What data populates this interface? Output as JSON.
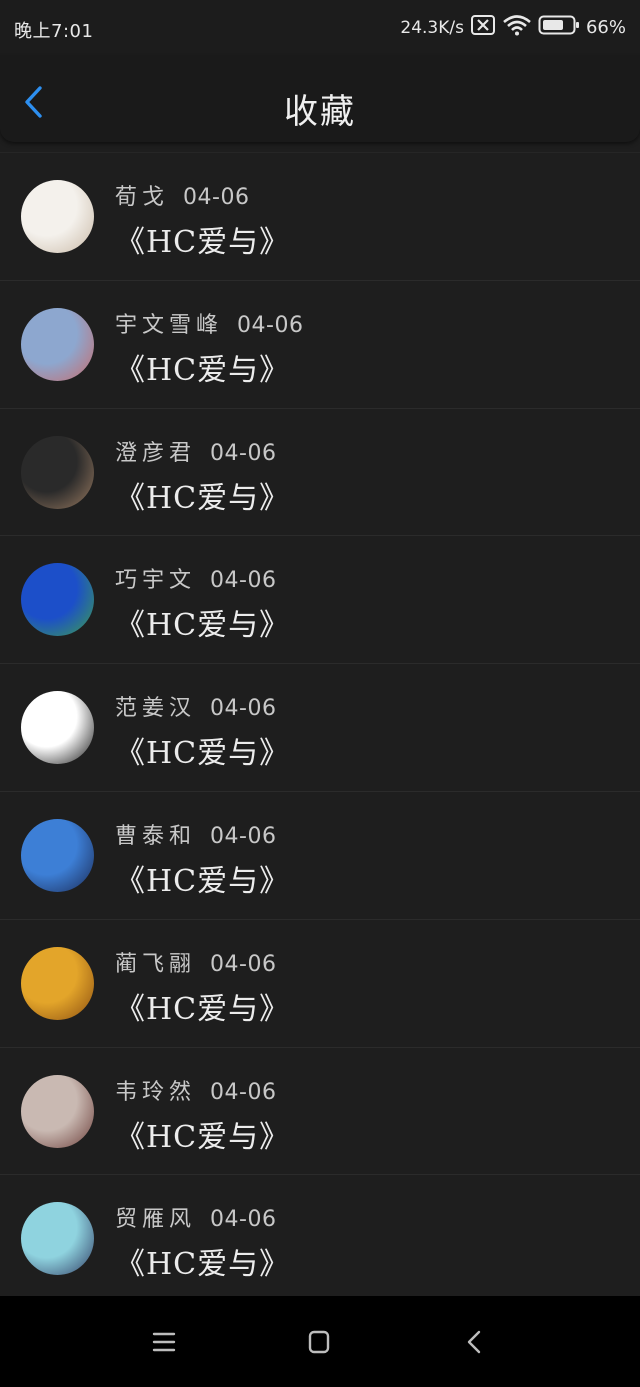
{
  "status_bar": {
    "time": "晚上7:01",
    "net_speed": "24.3K/s",
    "battery": "66%"
  },
  "header": {
    "title": "收藏"
  },
  "items": [
    {
      "name": "荀戈",
      "date": "04-06",
      "title": "《HC爱与》",
      "avatar_colors": [
        "#f4f1ec",
        "#c9b9a6"
      ]
    },
    {
      "name": "宇文雪峰",
      "date": "04-06",
      "title": "《HC爱与》",
      "avatar_colors": [
        "#8da7cf",
        "#c86a6a"
      ]
    },
    {
      "name": "澄彦君",
      "date": "04-06",
      "title": "《HC爱与》",
      "avatar_colors": [
        "#2a2a2a",
        "#9b7c62"
      ]
    },
    {
      "name": "巧宇文",
      "date": "04-06",
      "title": "《HC爱与》",
      "avatar_colors": [
        "#1c4fc9",
        "#3ea14a"
      ]
    },
    {
      "name": "范姜汉",
      "date": "04-06",
      "title": "《HC爱与》",
      "avatar_colors": [
        "#ffffff",
        "#111111"
      ]
    },
    {
      "name": "曹泰和",
      "date": "04-06",
      "title": "《HC爱与》",
      "avatar_colors": [
        "#3d7fd6",
        "#1b2a55"
      ]
    },
    {
      "name": "蔺飞翮",
      "date": "04-06",
      "title": "《HC爱与》",
      "avatar_colors": [
        "#e3a52a",
        "#8a4d11"
      ]
    },
    {
      "name": "韦玲然",
      "date": "04-06",
      "title": "《HC爱与》",
      "avatar_colors": [
        "#c9b9b2",
        "#6b3d39"
      ]
    },
    {
      "name": "贸雁风",
      "date": "04-06",
      "title": "《HC爱与》",
      "avatar_colors": [
        "#8fd3df",
        "#2f3b63"
      ]
    }
  ],
  "colors": {
    "accent": "#2d8ff0",
    "background": "#1e1e1e"
  },
  "icons": {
    "back": "chevron-left-icon",
    "menu": "menu-icon",
    "home": "home-square-icon",
    "nav_back": "nav-back-icon"
  }
}
